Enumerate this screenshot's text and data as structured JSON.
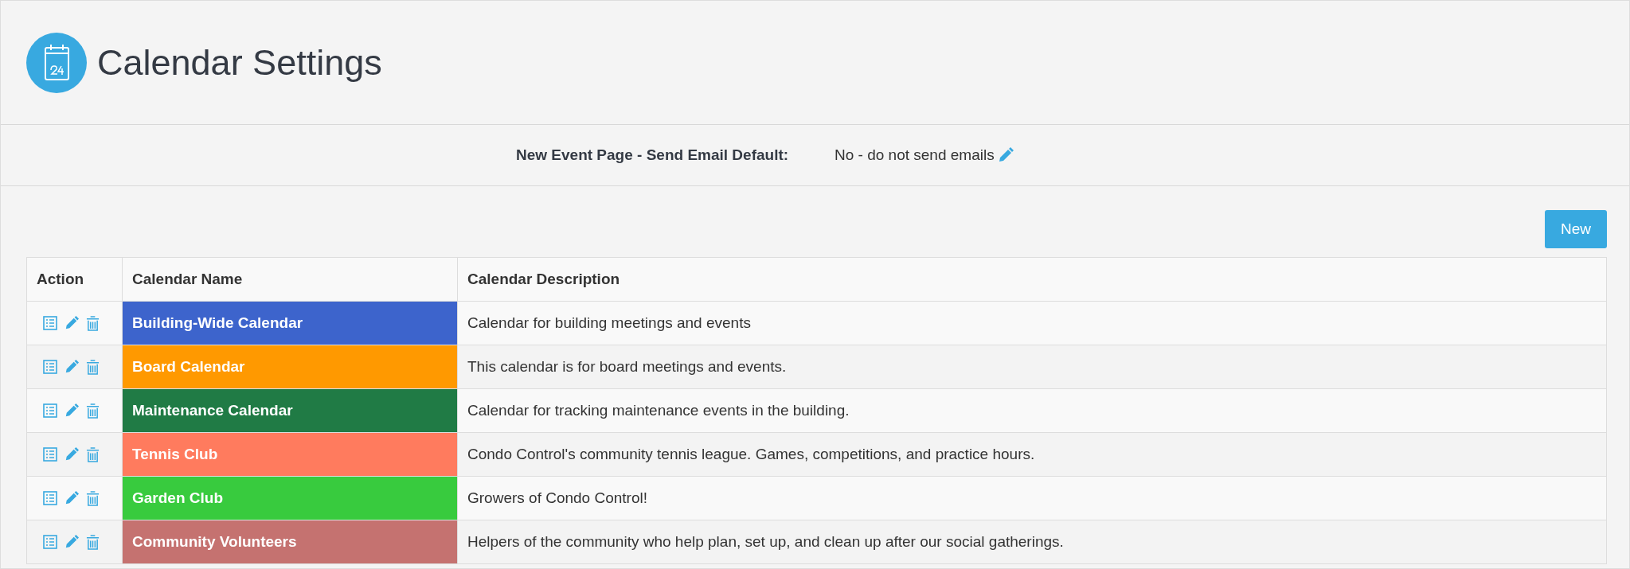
{
  "page": {
    "title": "Calendar Settings"
  },
  "setting": {
    "label": "New Event Page - Send Email Default:",
    "value": "No - do not send emails"
  },
  "new_button": "New",
  "table": {
    "columns": [
      "Action",
      "Calendar Name",
      "Calendar Description"
    ],
    "rows": [
      {
        "name": "Building-Wide Calendar",
        "color": "#3d64cc",
        "description": "Calendar for building meetings and events"
      },
      {
        "name": "Board Calendar",
        "color": "#ff9900",
        "description": "This calendar is for board meetings and events."
      },
      {
        "name": "Maintenance Calendar",
        "color": "#207b45",
        "description": "Calendar for tracking maintenance events in the building."
      },
      {
        "name": "Tennis Club",
        "color": "#ff7b5e",
        "description": "Condo Control's community tennis league. Games, competitions, and practice hours."
      },
      {
        "name": "Garden Club",
        "color": "#38cb3e",
        "description": "Growers of Condo Control!"
      },
      {
        "name": "Community Volunteers",
        "color": "#c57270",
        "description": "Helpers of the community who help plan, set up, and clean up after our social gatherings."
      }
    ]
  }
}
